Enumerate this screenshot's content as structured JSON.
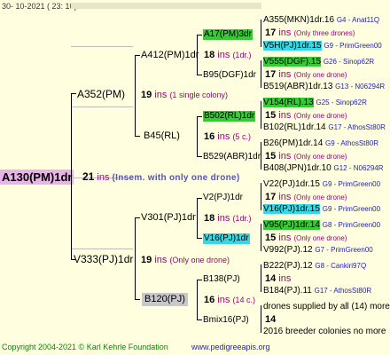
{
  "header": {
    "date": "30- 10-2021 ( 23: 10)"
  },
  "root": {
    "name": "A130(PM)1dr",
    "ins": "21",
    "ins_label": "ins",
    "note": "(Insem. with only one drone)"
  },
  "gen1": [
    {
      "name": "A352(PM)",
      "ins": "19",
      "ins_label": "ins",
      "note": "(1 single colony)"
    },
    {
      "name": "V333(PJ)1dr",
      "ins": "19",
      "ins_label": "ins",
      "note": "(Only one drone)"
    }
  ],
  "gen2": [
    {
      "name": "A412(PM)1dr",
      "ins": "18",
      "ins_label": "ins",
      "note": "(1dr.)"
    },
    {
      "name": "B45(RL)",
      "ins": "16",
      "ins_label": "ins",
      "note": "(5 c.)"
    },
    {
      "name": "V301(PJ)1dr",
      "ins": "18",
      "ins_label": "ins",
      "note": "(1dr.)"
    },
    {
      "name": "B120(PJ)",
      "ins": "16",
      "ins_label": "ins",
      "note": "(14 c.)"
    }
  ],
  "gen3": [
    {
      "name": "A17(PM)3dr"
    },
    {
      "name": "B95(DGF)1dr"
    },
    {
      "name": "B502(RL)1dr"
    },
    {
      "name": "B529(ABR)1dr"
    },
    {
      "name": "V2(PJ)1dr"
    },
    {
      "name": "V16(PJ)1dr"
    },
    {
      "name": "B138(PJ)"
    },
    {
      "name": "Bmix16(PJ)"
    }
  ],
  "gen4": [
    {
      "name": "A355(MKN)1dr.16",
      "extra": "G4 - Anat11Q"
    },
    {
      "ins": "17",
      "ins_label": "ins",
      "note": "(Only three drones)"
    },
    {
      "name": "V5H(PJ)1dr.15",
      "extra": "G9 - PrimGreen00"
    },
    {
      "name": "V555(DGF).15",
      "extra": "G26 - Sinop62R"
    },
    {
      "ins": "17",
      "ins_label": "ins",
      "note": "(Only one drone)"
    },
    {
      "name": "B519(ABR)1dr.13",
      "extra": "G13 - N06294R"
    },
    {
      "name": "V154(RL).13",
      "extra": "G25 - Sinop62R"
    },
    {
      "ins": "15",
      "ins_label": "ins",
      "note": "(Only one drone)"
    },
    {
      "name": "B102(RL)1dr.14",
      "extra": "G17 - AthosSt80R"
    },
    {
      "name": "B26(PM)1dr.14",
      "extra": "G9 - AthosSt80R"
    },
    {
      "ins": "15",
      "ins_label": "ins",
      "note": "(Only one drone)"
    },
    {
      "name": "B408(JPN)1dr.10",
      "extra": "G12 - N06294R"
    },
    {
      "name": "V22(PJ)1dr.15",
      "extra": "G9 - PrimGreen00"
    },
    {
      "ins": "17",
      "ins_label": "ins",
      "note": "(Only one drone)"
    },
    {
      "name": "V16(PJ)1dr.15",
      "extra": "G9 - PrimGreen00"
    },
    {
      "name": "V95(PJ)1dr.14",
      "extra": "G8 - PrimGreen00"
    },
    {
      "ins": "15",
      "ins_label": "ins",
      "note": "(Only one drone)"
    },
    {
      "name": "V992(PJ).12",
      "extra": "G7 - PrimGreen00"
    },
    {
      "name": "B222(PJ).12",
      "extra": "G8 - Cankiri97Q"
    },
    {
      "ins": "14",
      "ins_label": "ins"
    },
    {
      "name": "B184(PJ).11",
      "extra": "G17 - AthosSt80R"
    },
    {
      "text": "drones supplied by all (14) more"
    },
    {
      "ins": "14"
    },
    {
      "text": "2016 breeder colonies no more"
    }
  ],
  "footer": {
    "copyright": "Copyright 2004-2021 © Karl Kehrle Foundation",
    "site": "www.pedigreeapis.org"
  },
  "colors": {
    "root_bg": "#e8b4e8",
    "green": "#33cc33",
    "cyan": "#33d9e6",
    "gray": "#c8c8c8",
    "ins_color": "#a0007a",
    "poly_color": "#2222bb"
  }
}
